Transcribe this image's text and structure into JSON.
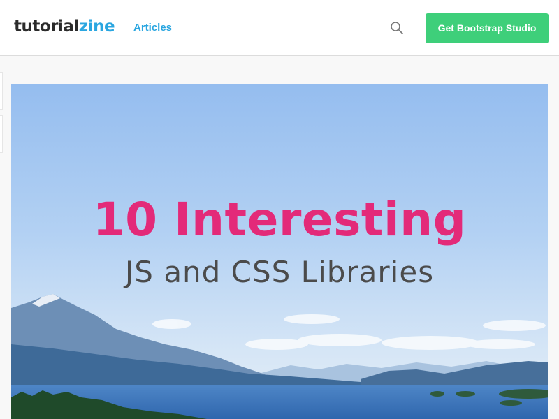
{
  "header": {
    "logo_part1": "tutorial",
    "logo_part2": "zine",
    "nav_articles": "Articles",
    "search_icon": "search-icon",
    "cta_label": "Get Bootstrap Studio"
  },
  "hero": {
    "title": "10 Interesting",
    "subtitle": "JS and CSS Libraries"
  },
  "colors": {
    "brand_blue": "#2aa6e0",
    "cta_green": "#3ecf7a",
    "title_pink": "#e32a79",
    "subtitle_gray": "#4b4b4b"
  }
}
